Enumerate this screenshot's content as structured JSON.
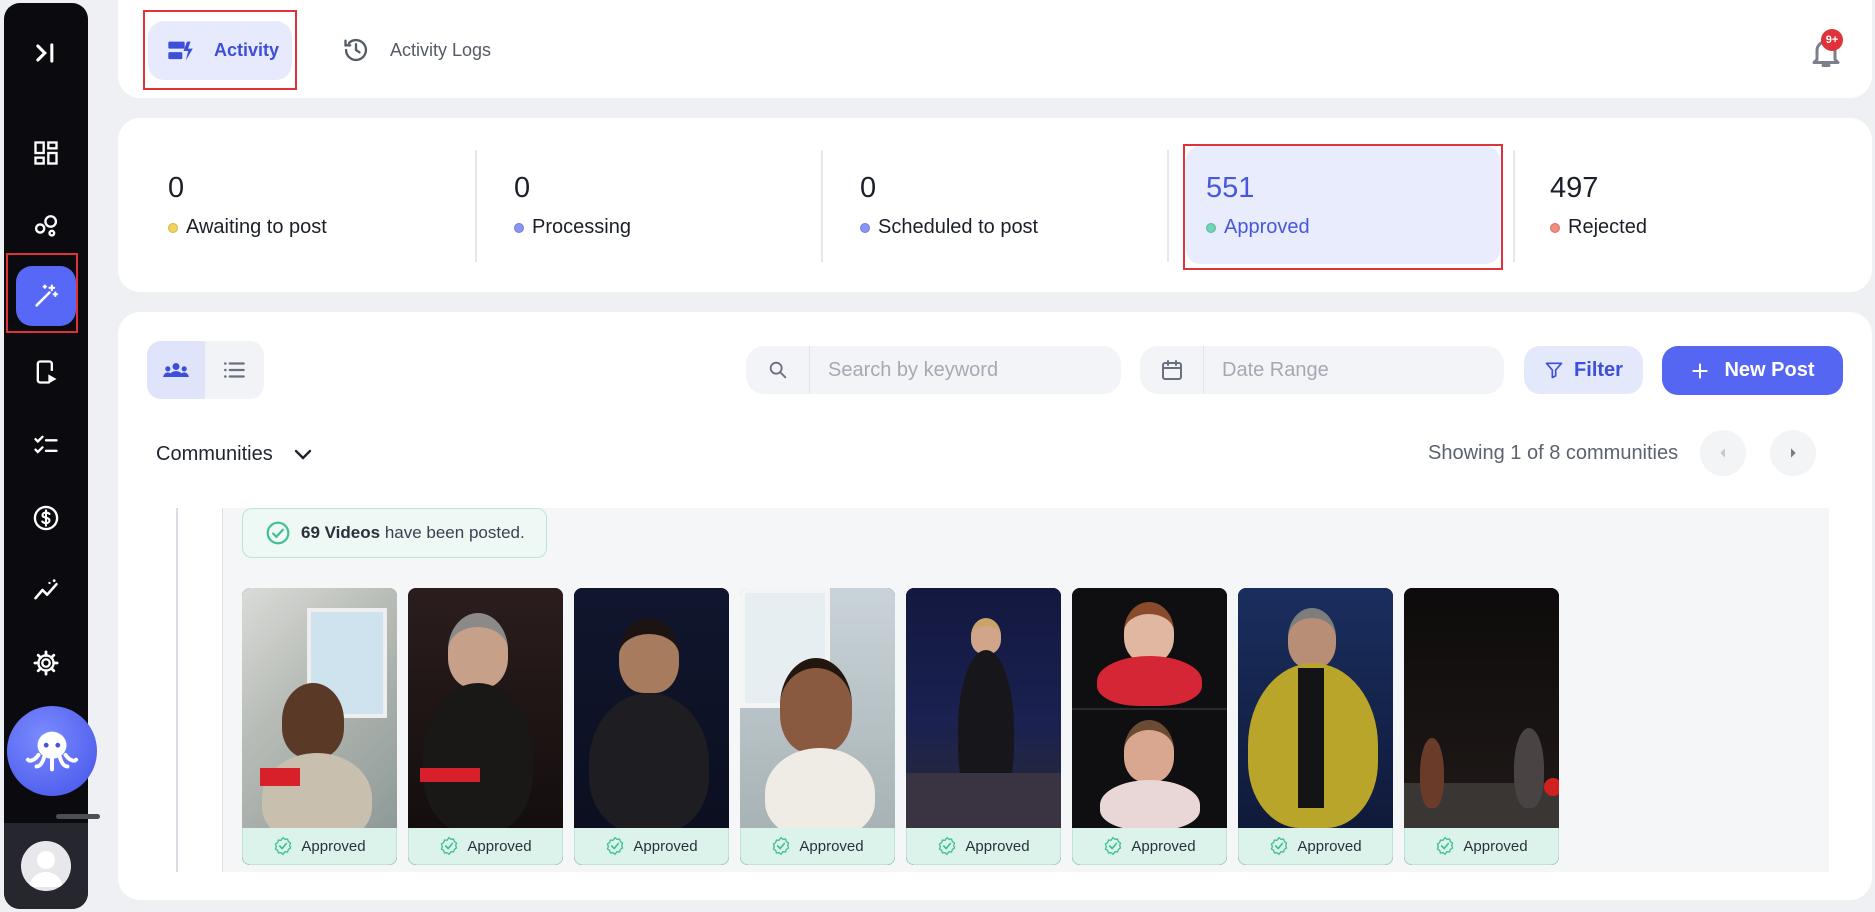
{
  "tabs": {
    "activity": "Activity",
    "activity_logs": "Activity Logs"
  },
  "notifications": {
    "badge": "9+"
  },
  "stats": [
    {
      "value": "0",
      "label": "Awaiting to post",
      "color": "#f2d45c"
    },
    {
      "value": "0",
      "label": "Processing",
      "color": "#8893f5"
    },
    {
      "value": "0",
      "label": "Scheduled to post",
      "color": "#8893f5"
    },
    {
      "value": "551",
      "label": "Approved",
      "color": "#6fd6b6"
    },
    {
      "value": "497",
      "label": "Rejected",
      "color": "#f28c7c"
    }
  ],
  "toolbar": {
    "search_placeholder": "Search by keyword",
    "date_placeholder": "Date Range",
    "filter_label": "Filter",
    "new_post_label": "New Post"
  },
  "communities": {
    "label": "Communities",
    "showing": "Showing 1 of 8 communities"
  },
  "posted": {
    "count": "69 Videos",
    "text": "have been posted."
  },
  "cards": [
    {
      "status": "Approved"
    },
    {
      "status": "Approved"
    },
    {
      "status": "Approved"
    },
    {
      "status": "Approved"
    },
    {
      "status": "Approved"
    },
    {
      "status": "Approved"
    },
    {
      "status": "Approved"
    },
    {
      "status": "Approved"
    }
  ],
  "colors": {
    "accent": "#5566f2",
    "highlight": "#e0323a",
    "approved_bg": "#dcf3ec"
  }
}
